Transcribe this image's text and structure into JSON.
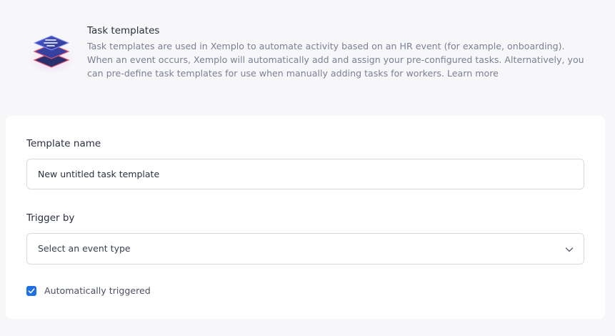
{
  "header": {
    "title": "Task templates",
    "description": "Task templates are used in Xemplo to automate activity based on an HR event (for example, onboarding). When an event occurs, Xemplo will automatically add and assign your pre-configured tasks. Alternatively, you can pre-define task templates for use when manually adding tasks for workers.",
    "learn_more": "Learn more",
    "icon": "layers-stack-icon"
  },
  "form": {
    "template_name_label": "Template name",
    "template_name_value": "New untitled task template",
    "trigger_label": "Trigger by",
    "trigger_value": "Select an event type",
    "auto_trigger_label": "Automatically triggered",
    "auto_trigger_checked": true
  },
  "colors": {
    "accent": "#1f6fe5",
    "page_bg": "#f7f7fa",
    "card_bg": "#ffffff",
    "border": "#d7d9e0",
    "muted_text": "#7a7f93"
  }
}
